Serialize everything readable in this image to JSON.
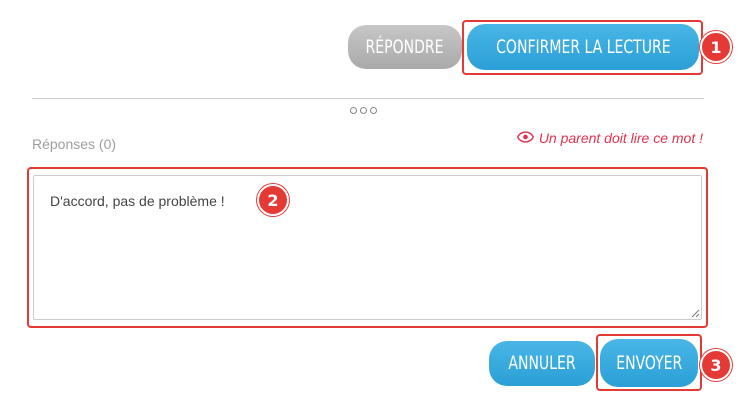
{
  "actions": {
    "reply_label": "RÉPONDRE",
    "confirm_label": "CONFIRMER LA LECTURE"
  },
  "replies": {
    "label": "Réponses (0)",
    "parent_notice": "Un parent doit lire ce mot !",
    "notice_icon": "eye-icon"
  },
  "composer": {
    "value": "D'accord, pas de problème !"
  },
  "form_actions": {
    "cancel_label": "ANNULER",
    "send_label": "ENVOYER"
  },
  "annotations": {
    "badge_1": "1",
    "badge_2": "2",
    "badge_3": "3"
  },
  "colors": {
    "primary_button": "#2a9fd6",
    "secondary_button": "#a9a9a9",
    "notice": "#e0324e",
    "highlight": "#e53935"
  }
}
